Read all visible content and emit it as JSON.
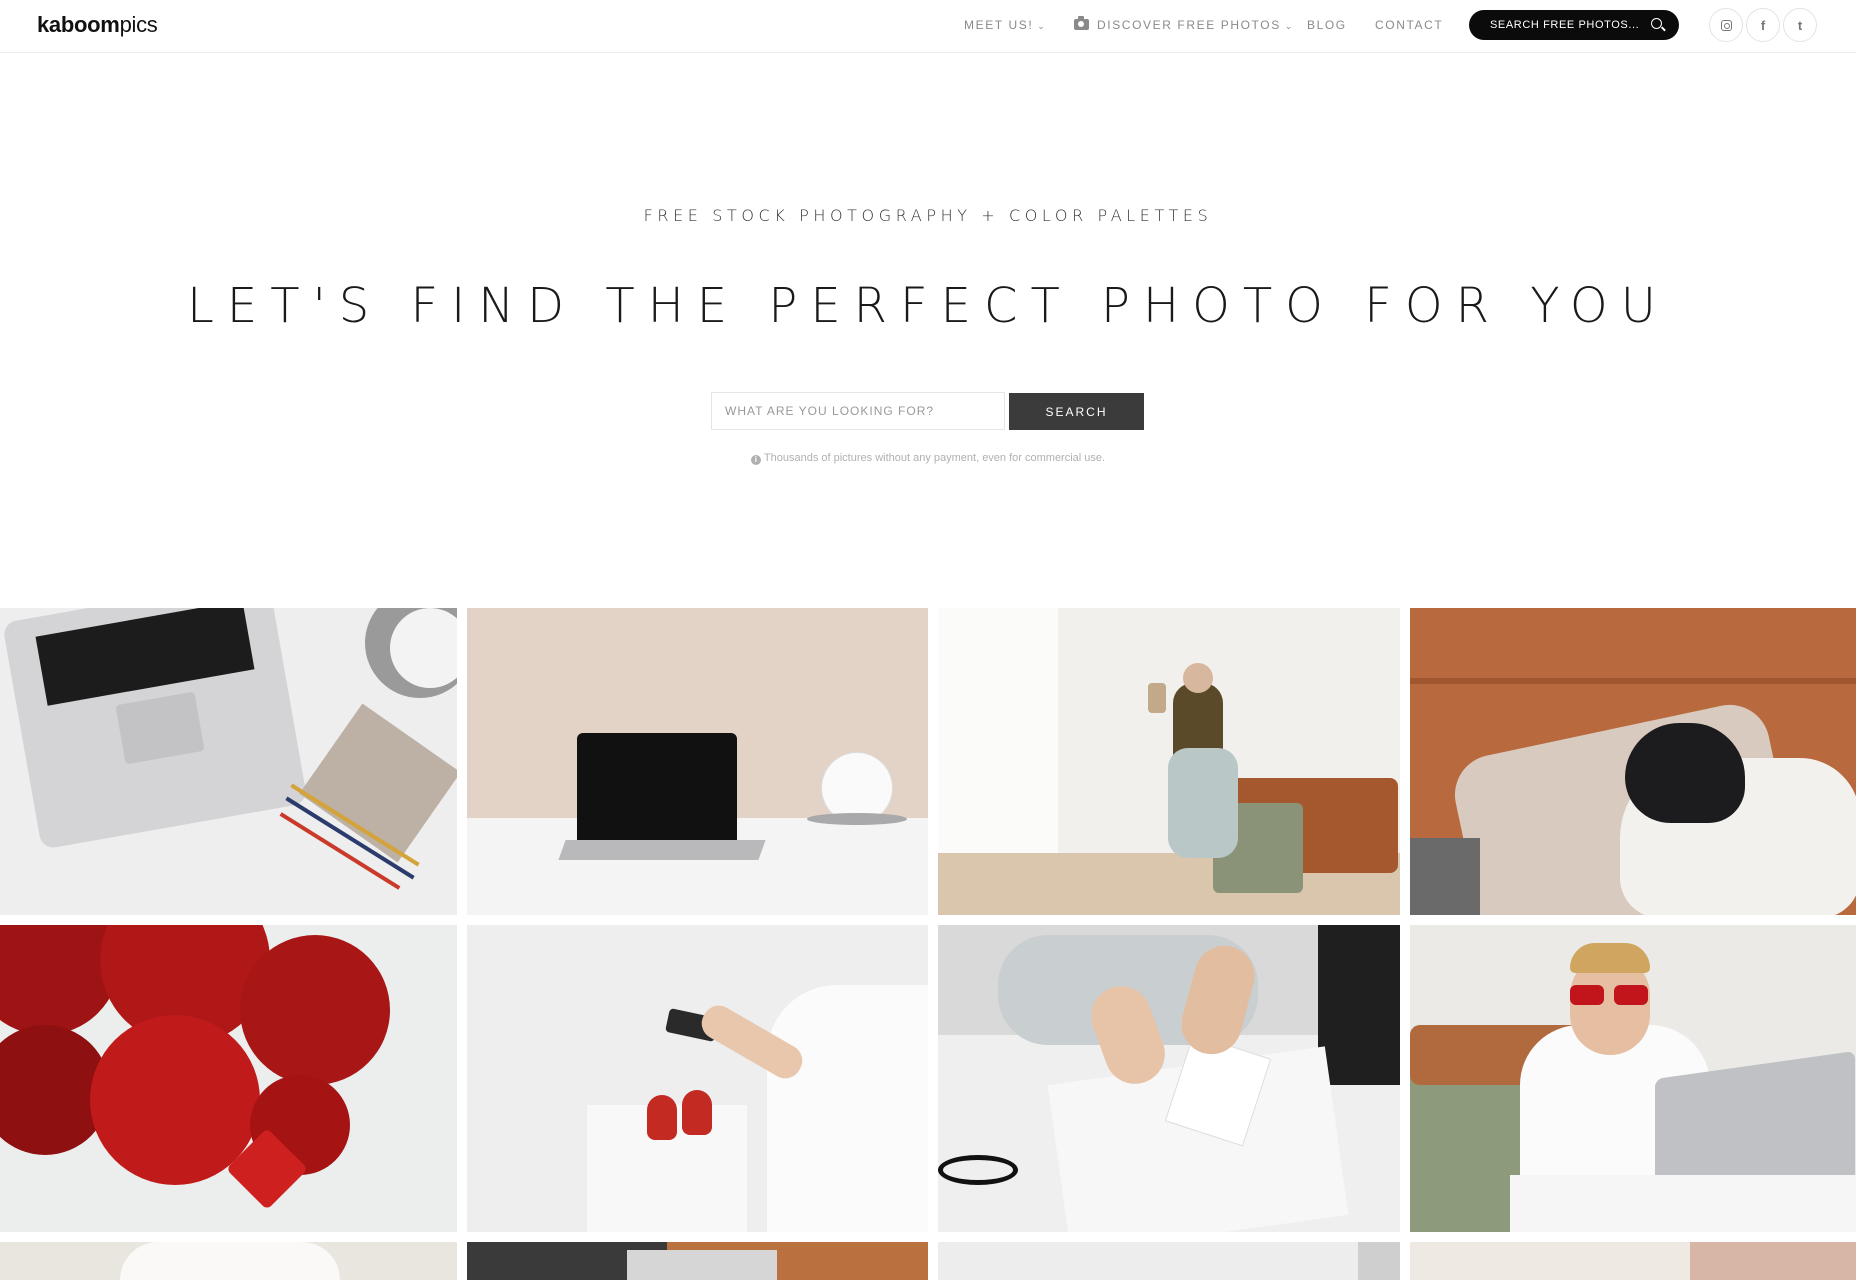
{
  "header": {
    "logo_bold": "kaboom",
    "logo_light": "pics",
    "nav": {
      "meet_us": "MEET US!",
      "discover": "DISCOVER FREE PHOTOS",
      "blog": "BLOG",
      "contact": "CONTACT"
    },
    "search_placeholder": "SEARCH FREE PHOTOS...",
    "social": [
      "instagram-icon",
      "facebook-icon",
      "twitter-icon"
    ],
    "social_glyphs": {
      "facebook": "f",
      "twitter": "t"
    }
  },
  "hero": {
    "tagline": "FREE STOCK PHOTOGRAPHY + COLOR PALETTES",
    "headline": "LET'S FIND THE PERFECT PHOTO FOR YOU",
    "search_placeholder": "WHAT ARE YOU LOOKING FOR?",
    "search_button": "SEARCH",
    "note": "Thousands of pictures without any payment, even for commercial use."
  },
  "colors": {
    "header_search_bg": "#0b0b0b",
    "search_button_bg": "#3b3b3b",
    "muted_text": "#8a8a8a"
  },
  "gallery": {
    "photos": [
      "laptop-flatlay-photo",
      "laptop-desk-lamp-photo",
      "woman-phone-armchair-photo",
      "dog-leather-sofa-photo",
      "red-roses-heart-photo",
      "woman-phone-red-shoes-photo",
      "hands-writing-card-photo",
      "woman-sunglasses-laptop-photo",
      "photo-row3-1",
      "photo-row3-2",
      "photo-row3-3",
      "photo-row3-4"
    ]
  }
}
